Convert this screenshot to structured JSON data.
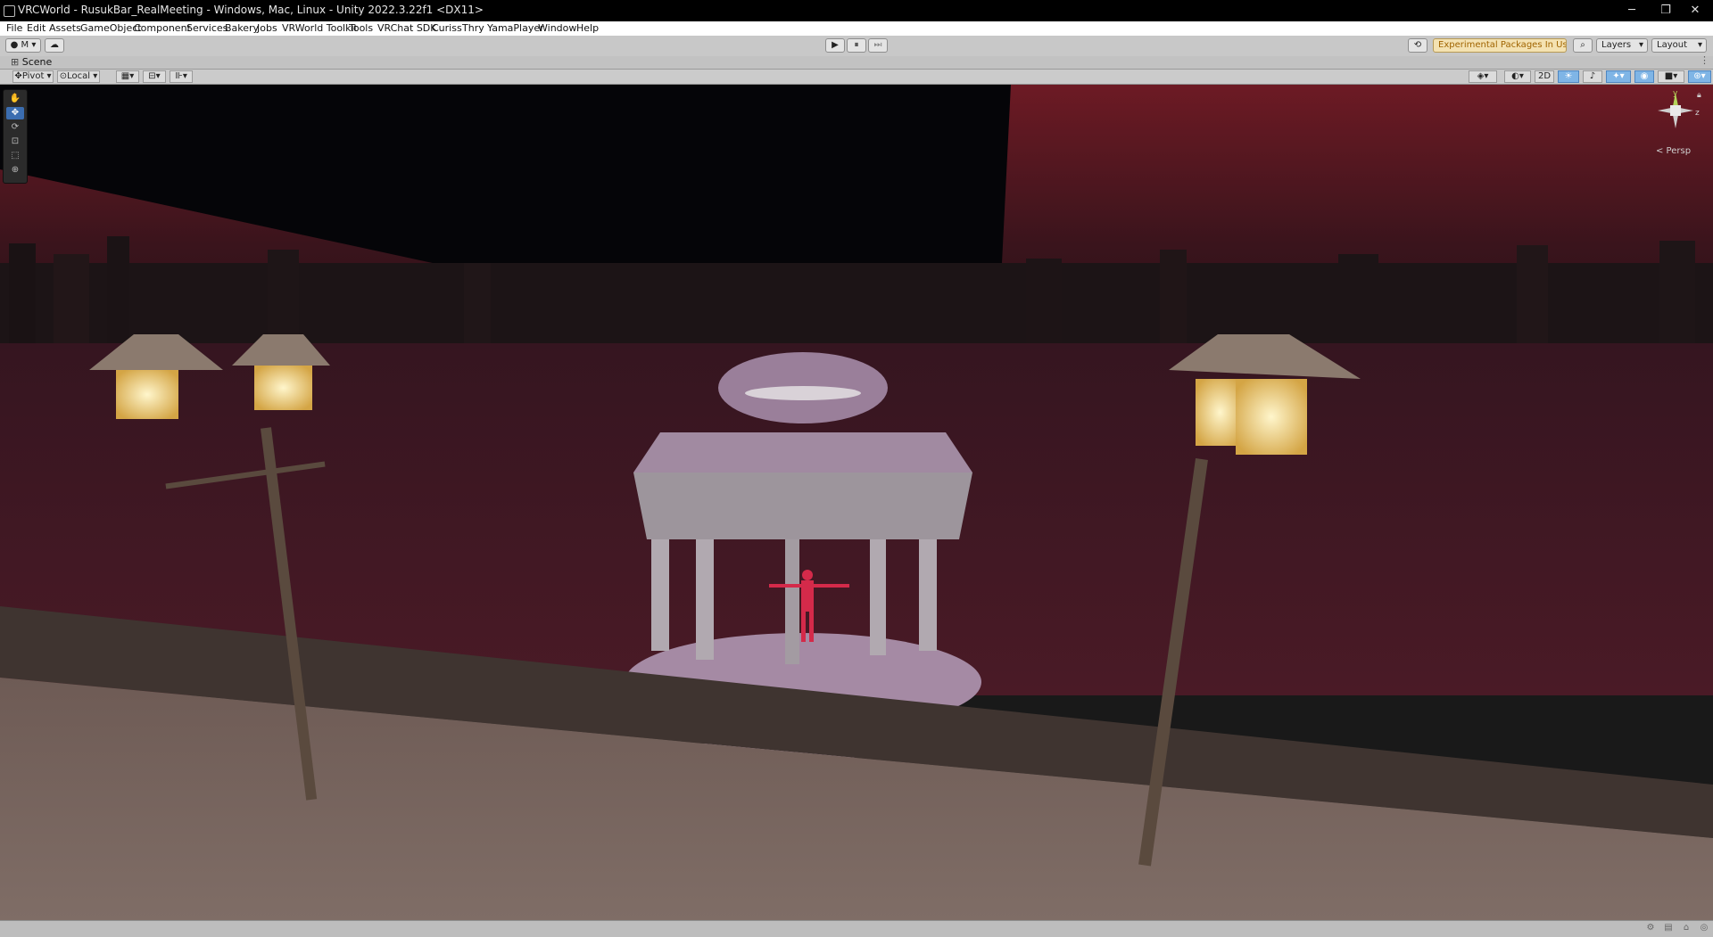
{
  "window": {
    "title": "VRCWorld - RusukBar_RealMeeting - Windows, Mac, Linux - Unity 2022.3.22f1 <DX11>",
    "minimize_glyph": "─",
    "maximize_glyph": "❐",
    "close_glyph": "✕"
  },
  "menu": {
    "items": [
      {
        "label": "File"
      },
      {
        "label": "Edit"
      },
      {
        "label": "Assets"
      },
      {
        "label": "GameObject"
      },
      {
        "label": "Component"
      },
      {
        "label": "Services"
      },
      {
        "label": "Bakery"
      },
      {
        "label": "Jobs"
      },
      {
        "label": "VRWorld Toolkit"
      },
      {
        "label": "Tools"
      },
      {
        "label": "VRChat SDK"
      },
      {
        "label": "Curiss"
      },
      {
        "label": "Thry"
      },
      {
        "label": "YamaPlayer"
      },
      {
        "label": "Window"
      },
      {
        "label": "Help"
      }
    ]
  },
  "toolbar": {
    "account_label": "M",
    "account_icon": "user-icon",
    "cloud_icon": "cloud-icon",
    "play_glyph": "▶",
    "pause_glyph": "⏸",
    "step_glyph": "⏭",
    "history_icon": "history-icon",
    "experimental_label": "Experimental Packages In Use ▾",
    "search_icon": "search-icon",
    "layers_label": "Layers",
    "layout_label": "Layout"
  },
  "scene_tab": {
    "icon": "scene-grid-icon",
    "label": "Scene",
    "menu_glyph": "⋮"
  },
  "scene_toolbar": {
    "pivot_label": "Pivot",
    "local_label": "Local",
    "mode_2d_label": "2D",
    "grid_icon": "grid-icon",
    "snap_icon": "snap-icon",
    "increment_icon": "increment-icon",
    "draw_mode_icon": "draw-mode-icon",
    "shading_icon": "shading-sphere-icon",
    "lighting_icon": "lighting-icon",
    "audio_icon": "audio-icon",
    "fx_icon": "effects-icon",
    "hidden_icon": "visibility-icon",
    "camera_icon": "camera-icon",
    "gizmos_icon": "gizmos-icon"
  },
  "tools": [
    "hand-tool-icon",
    "move-tool-icon",
    "rotate-tool-icon",
    "scale-tool-icon",
    "rect-tool-icon",
    "transform-tool-icon"
  ],
  "gizmo": {
    "y_label": "y",
    "z_label": "z",
    "persp_label": "< Persp",
    "lock_icon": "lock-icon"
  },
  "status": {
    "icons": [
      "bug-icon",
      "progress-icon",
      "network-icon",
      "cache-icon"
    ]
  },
  "colors": {
    "sky_top": "#6d1a24",
    "water": "#3a1420",
    "selection_blue": "#3b6db0",
    "experimental_amber": "#a06400"
  }
}
